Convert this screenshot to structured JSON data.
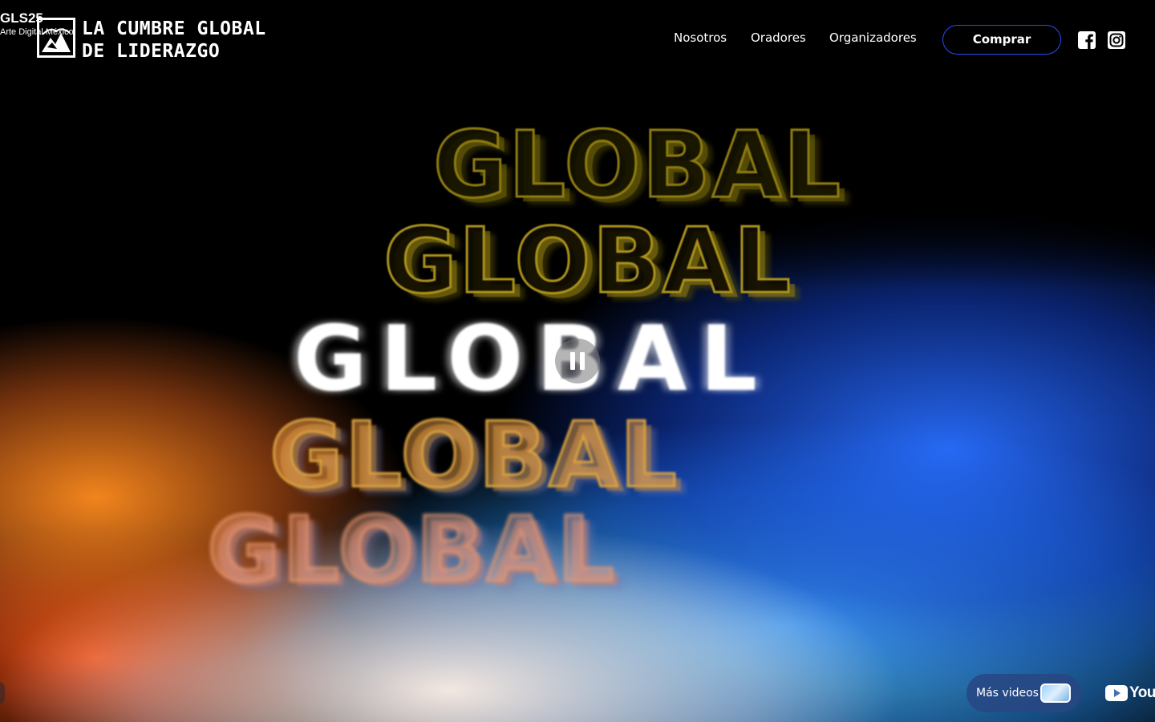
{
  "header": {
    "tag_title": "GLS25",
    "tag_subtitle": "Arte Digital México",
    "logo_line1": "LA CUMBRE GLOBAL",
    "logo_line2": "DE LIDERAZGO",
    "nav": [
      "Nosotros",
      "Oradores",
      "Organizadores"
    ],
    "buy_label": "Comprar",
    "social_icons": [
      "facebook-icon",
      "instagram-icon"
    ]
  },
  "hero": {
    "words": [
      "GLOBAL",
      "GLOBAL",
      "GLOBAL",
      "GLOBAL",
      "GLOBAL"
    ],
    "state": "playing"
  },
  "footer": {
    "more_videos_label": "Más videos",
    "youtube_label": "YouTube"
  },
  "colors": {
    "accent_border": "#2a4bff",
    "background": "#000000",
    "orange_glow": "#ff8c1e",
    "blue_glow": "#286eff",
    "gold_outline": "#a8901a"
  }
}
